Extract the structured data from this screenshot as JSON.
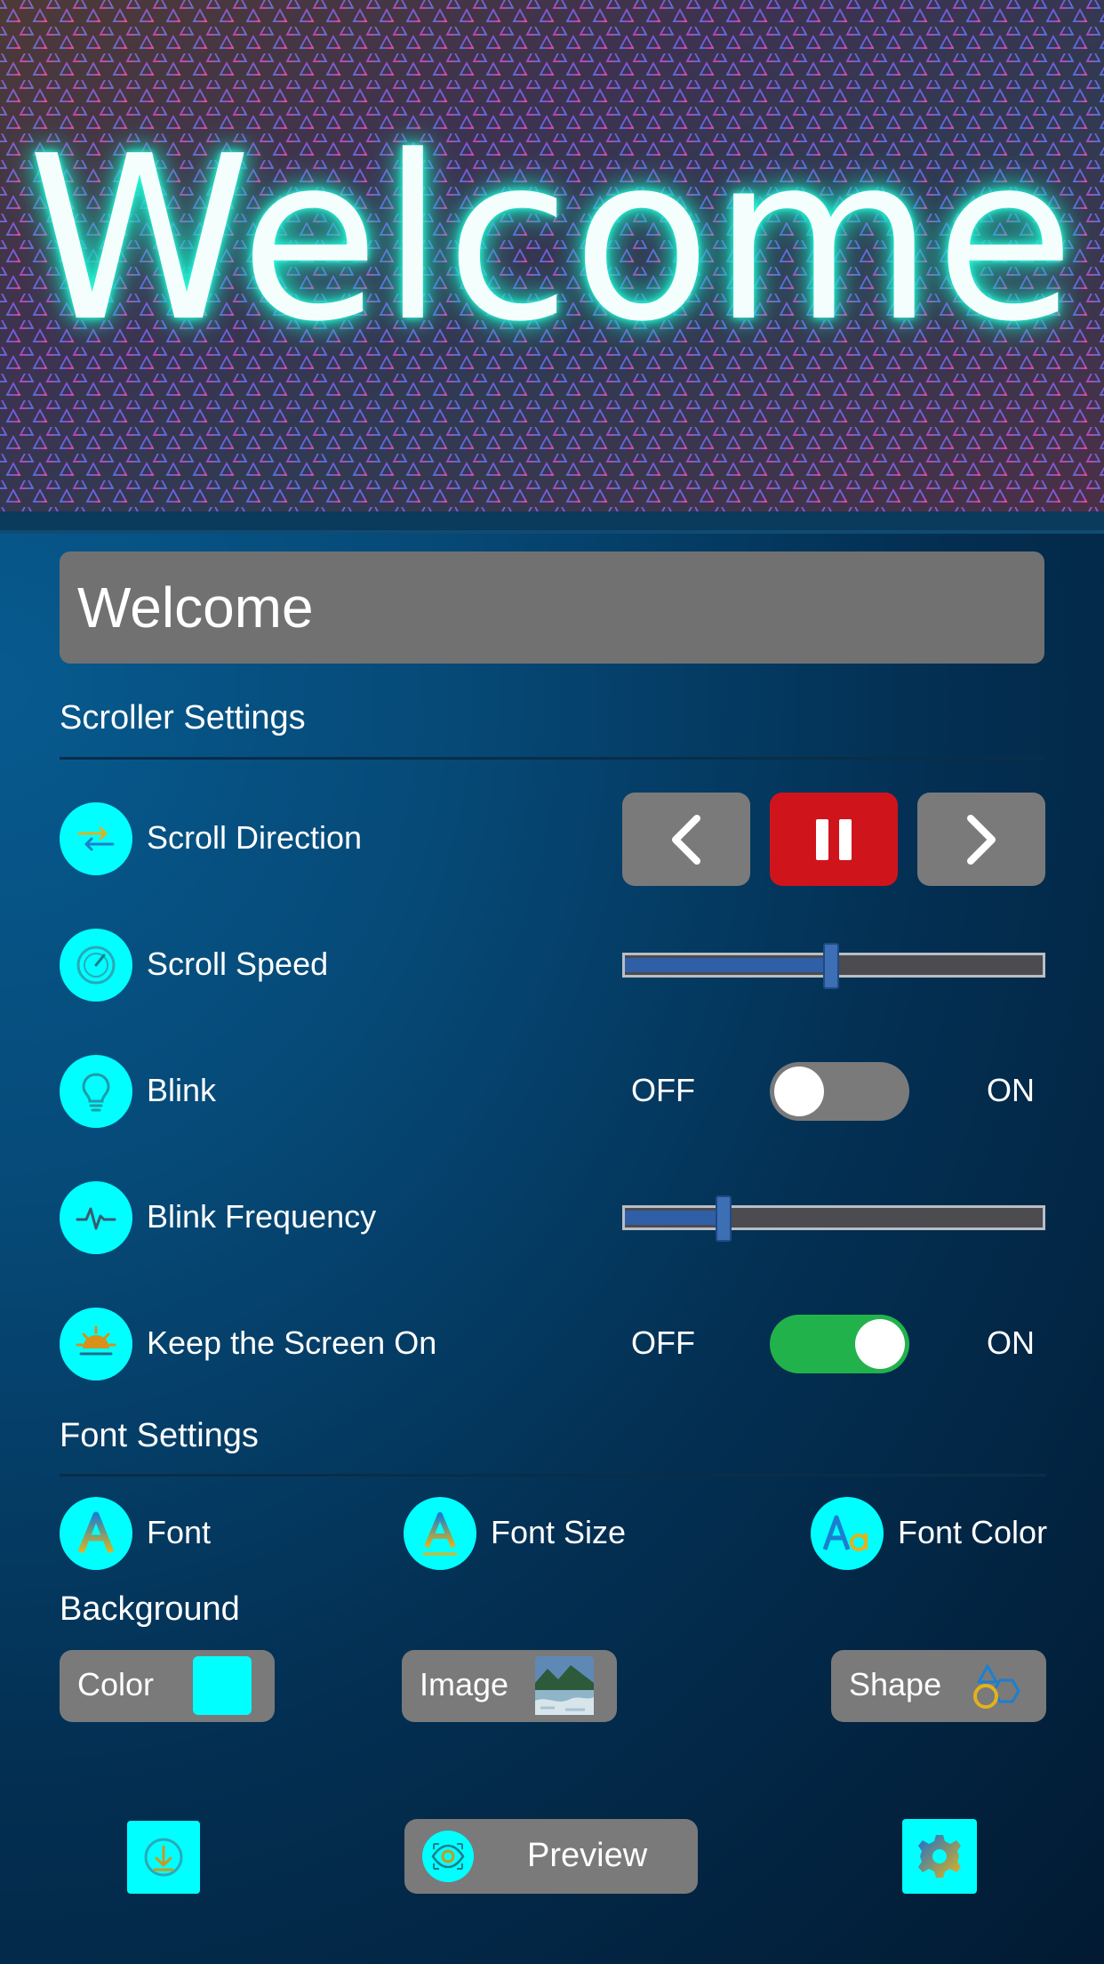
{
  "banner": {
    "text": "Welcome"
  },
  "text_input": {
    "value": "Welcome"
  },
  "scroller_settings": {
    "title": "Scroller Settings",
    "scroll_direction": {
      "label": "Scroll Direction",
      "icon": "direction-arrows-icon"
    },
    "scroll_speed": {
      "label": "Scroll Speed",
      "icon": "speedometer-icon",
      "value_fraction": 0.5
    },
    "blink": {
      "label": "Blink",
      "icon": "lightbulb-icon",
      "off_label": "OFF",
      "on_label": "ON",
      "enabled": false
    },
    "blink_frequency": {
      "label": "Blink Frequency",
      "icon": "pulse-wave-icon",
      "value_fraction": 0.24
    },
    "keep_screen_on": {
      "label": "Keep the Screen On",
      "icon": "sun-icon",
      "off_label": "OFF",
      "on_label": "ON",
      "enabled": true
    }
  },
  "font_settings": {
    "title": "Font Settings",
    "font": {
      "label": "Font",
      "icon": "letter-a-icon"
    },
    "font_size": {
      "label": "Font Size",
      "icon": "letter-a-size-icon"
    },
    "font_color": {
      "label": "Font Color",
      "icon": "letters-aa-icon"
    }
  },
  "background": {
    "title": "Background",
    "color": {
      "label": "Color",
      "swatch": "#00ffff"
    },
    "image": {
      "label": "Image",
      "icon": "landscape-thumbnail-icon"
    },
    "shape": {
      "label": "Shape",
      "icon": "shapes-icon"
    }
  },
  "bottom_bar": {
    "download_icon": "download-icon",
    "preview_label": "Preview",
    "preview_icon": "eye-icon",
    "settings_icon": "gear-icon"
  },
  "colors": {
    "accent_cyan": "#00ffff",
    "pause_red": "#d0141c",
    "toggle_on_green": "#22b24c",
    "button_gray": "#7a7a7a"
  }
}
